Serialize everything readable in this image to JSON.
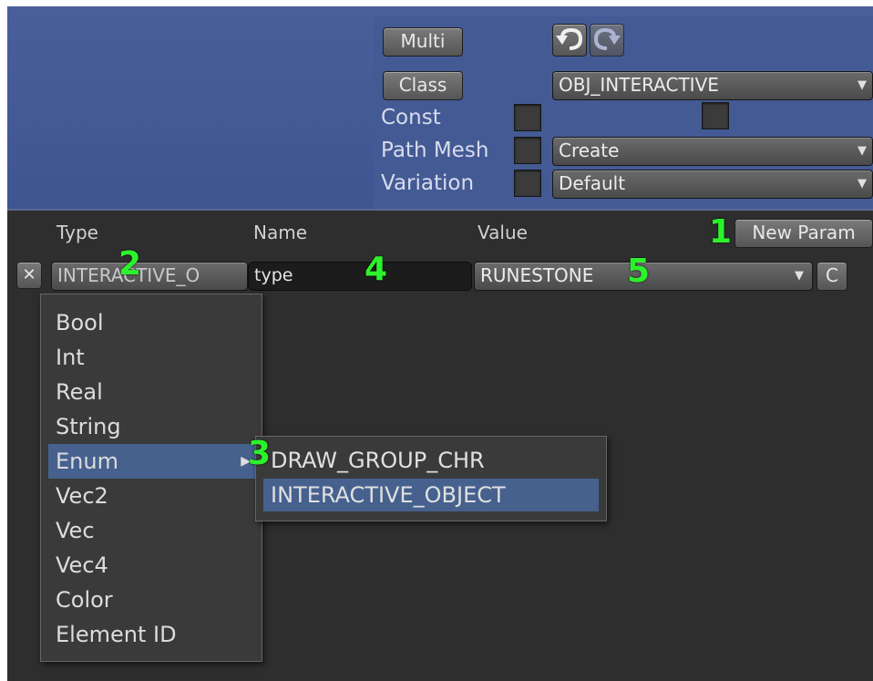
{
  "top": {
    "multi_label": "Multi",
    "class_label": "Class",
    "class_value": "OBJ_INTERACTIVE",
    "const_label": "Const",
    "path_mesh_label": "Path Mesh",
    "path_mesh_value": "Create",
    "variation_label": "Variation",
    "variation_value": "Default"
  },
  "params": {
    "headers": {
      "type": "Type",
      "name": "Name",
      "value": "Value"
    },
    "new_param_label": "New Param",
    "remove_label": "✕",
    "row": {
      "type_value": "INTERACTIVE_O",
      "name_value": "type",
      "value_value": "RUNESTONE",
      "c_label": "C"
    }
  },
  "type_menu": {
    "items": [
      "Bool",
      "Int",
      "Real",
      "String",
      "Enum",
      "Vec2",
      "Vec",
      "Vec4",
      "Color",
      "Element ID"
    ],
    "highlighted": "Enum"
  },
  "enum_submenu": {
    "items": [
      "DRAW_GROUP_CHR",
      "INTERACTIVE_OBJECT"
    ],
    "highlighted": "INTERACTIVE_OBJECT"
  },
  "callouts": [
    "1",
    "2",
    "3",
    "4",
    "5"
  ],
  "colors": {
    "callout": "#2cf22c",
    "highlight": "#46618e",
    "top_background": "#445a95",
    "dark_background": "#2e2e2e"
  }
}
